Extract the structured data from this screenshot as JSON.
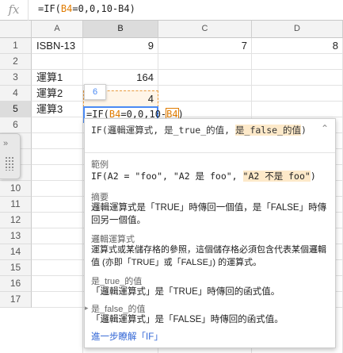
{
  "formula_bar": {
    "fx_label": "fx",
    "formula_prefix": "=IF(",
    "formula_ref": "B4",
    "formula_suffix": "=0,0,10-B4)",
    "ref_color": "#e07b00"
  },
  "columns": [
    "A",
    "B",
    "C",
    "D"
  ],
  "rows": [
    "1",
    "2",
    "3",
    "4",
    "5",
    "6",
    "7",
    "8",
    "9",
    "10",
    "11",
    "12",
    "13",
    "14",
    "15",
    "16",
    "17"
  ],
  "cells": {
    "A1": "ISBN-13",
    "B1": "9",
    "C1": "7",
    "D1": "8",
    "A3": "運算1",
    "B3": "164",
    "A4": "運算2",
    "B4": "4",
    "A5": "運算3"
  },
  "editor": {
    "part1": "=IF(",
    "ref": "B4",
    "part2": "=0,0,10-",
    "ref2": "B4",
    "part3": ")"
  },
  "arg_index_tip": "6",
  "help": {
    "signature_part1": "IF(邏輯運算式, 是_true_的值, ",
    "signature_highlight": "是_false_的值",
    "signature_part2": ")",
    "example_title": "範例",
    "example_part1": "IF(A2 = \"foo\", \"A2 是 foo\", ",
    "example_highlight": "\"A2 不是 foo\"",
    "example_part2": ")",
    "summary_title": "摘要",
    "summary_body": "邏輯運算式是「TRUE」時傳回一個值，是「FALSE」時傳回另一個值。",
    "logical_title": "邏輯運算式",
    "logical_body": "運算式或某儲存格的參照，這個儲存格必須包含代表某個邏輯值 (亦即「TRUE」或「FALSE」) 的運算式。",
    "true_title": "是_true_的值",
    "true_body": "「邏輯運算式」是「TRUE」時傳回的函式值。",
    "false_title": "是_false_的值",
    "false_body": "「邏輯運算式」是「FALSE」時傳回的函式值。",
    "learn_more": "進一步瞭解「IF」",
    "link_color": "#3367d6",
    "highlight_color": "#fde9c9"
  },
  "side_panel": {
    "chevron": "»",
    "grip": "grip-dots-icon"
  }
}
